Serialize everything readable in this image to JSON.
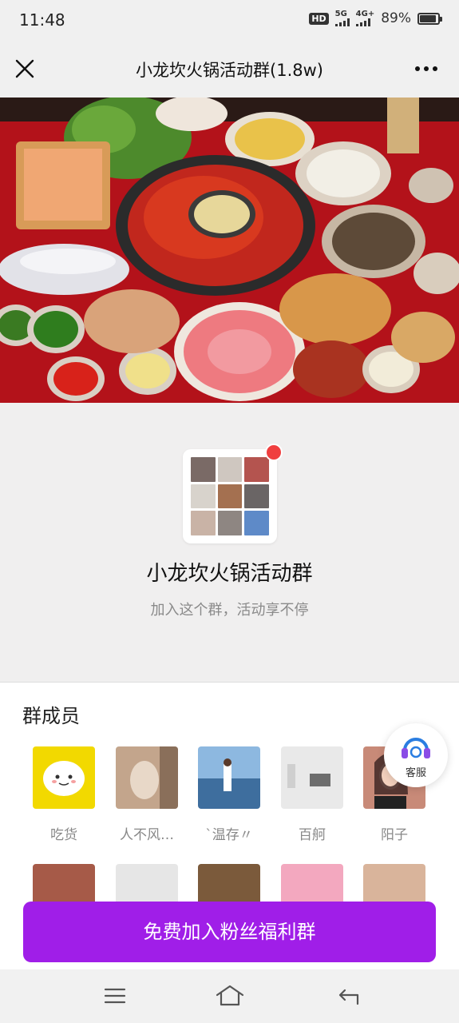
{
  "status_bar": {
    "time": "11:48",
    "hd": "HD",
    "net_1": "5G",
    "net_2": "4G+",
    "battery": "89%",
    "battery_level": 0.89
  },
  "title_bar": {
    "close_icon": "close-icon",
    "title": "小龙坎火锅活动群(1.8w)",
    "more_icon": "more-icon"
  },
  "banner": {
    "image": "hotpot-feast-photo"
  },
  "group": {
    "name": "小龙坎火锅活动群",
    "description": "加入这个群，活动享不停",
    "avatar_colors": [
      "#7a6a66",
      "#cfc7c0",
      "#b4544f",
      "#d8d3cc",
      "#a47050",
      "#6a6565",
      "#c9b3a6",
      "#8e8682",
      "#5e8ac8"
    ]
  },
  "members": {
    "title": "群成员",
    "row1": [
      {
        "name": "吃货",
        "color": "#f2d900"
      },
      {
        "name": "人不风…",
        "color": "#c3a58c"
      },
      {
        "name": "`温存〃",
        "color": "#8db8e0"
      },
      {
        "name": "百舸",
        "color": "#e9e9e9"
      },
      {
        "name": "阳子",
        "color": "#c88a78"
      }
    ],
    "row2_colors": [
      "#a65a48",
      "#e6e6e6",
      "#7b5a3b",
      "#f3a8bf",
      "#d9b49b"
    ]
  },
  "service": {
    "label": "客服",
    "icon": "headset-icon"
  },
  "join_button": {
    "label": "免费加入粉丝福利群"
  },
  "nav": {
    "menu_icon": "menu-icon",
    "home_icon": "home-icon",
    "back_icon": "back-icon"
  }
}
